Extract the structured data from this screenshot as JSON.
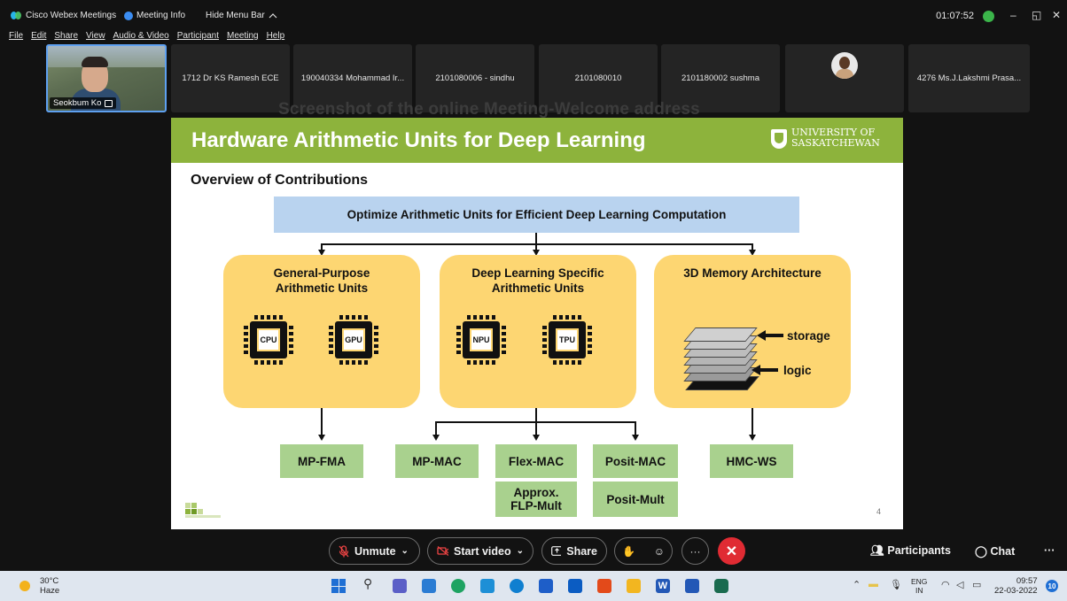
{
  "titlebar": {
    "app_name": "Cisco Webex Meetings",
    "meeting_info": "Meeting Info",
    "hide_menu": "Hide Menu Bar",
    "hide_menu_icon": "chevron-up-icon",
    "timer": "01:07:52",
    "minimize": "–",
    "restore": "◱",
    "close": "✕"
  },
  "menu": [
    "File",
    "Edit",
    "Share",
    "View",
    "Audio & Video",
    "Participant",
    "Meeting",
    "Help"
  ],
  "participants": {
    "video_name": "Seokbum Ko",
    "tiles": [
      "1712 Dr KS Ramesh ECE",
      "190040334 Mohammad Ir...",
      "2101080006 - sindhu",
      "2101080010",
      "2101180002 sushma",
      "",
      "4276 Ms.J.Lakshmi Prasa..."
    ]
  },
  "caption": "Screenshot of the online Meeting-Welcome address",
  "slide": {
    "title": "Hardware Arithmetic Units for Deep Learning",
    "university_line1": "UNIVERSITY OF",
    "university_line2": "SASKATCHEWAN",
    "subtitle": "Overview of Contributions",
    "top_box": "Optimize Arithmetic Units for Efficient Deep Learning Computation",
    "groups": [
      {
        "title": "General-Purpose\nArithmetic Units",
        "chips": [
          "CPU",
          "GPU"
        ]
      },
      {
        "title": "Deep Learning Specific\nArithmetic Units",
        "chips": [
          "NPU",
          "TPU"
        ]
      },
      {
        "title": "3D Memory Architecture",
        "storage": "storage",
        "logic": "logic"
      }
    ],
    "leaves": [
      "MP-FMA",
      "MP-MAC",
      "Flex-MAC",
      "Posit-MAC",
      "HMC-WS",
      "Approx.\nFLP-Mult",
      "Posit-Mult"
    ],
    "page_number": "4"
  },
  "controls": {
    "unmute": "Unmute",
    "start_video": "Start video",
    "share": "Share",
    "participants": "Participants",
    "chat": "Chat",
    "more": "···",
    "end_color": "#e02b33"
  },
  "taskbar": {
    "temperature": "30°C",
    "weather": "Haze",
    "lang1": "ENG",
    "lang2": "IN",
    "time": "09:57",
    "date": "22-03-2022",
    "notifications": "10"
  }
}
